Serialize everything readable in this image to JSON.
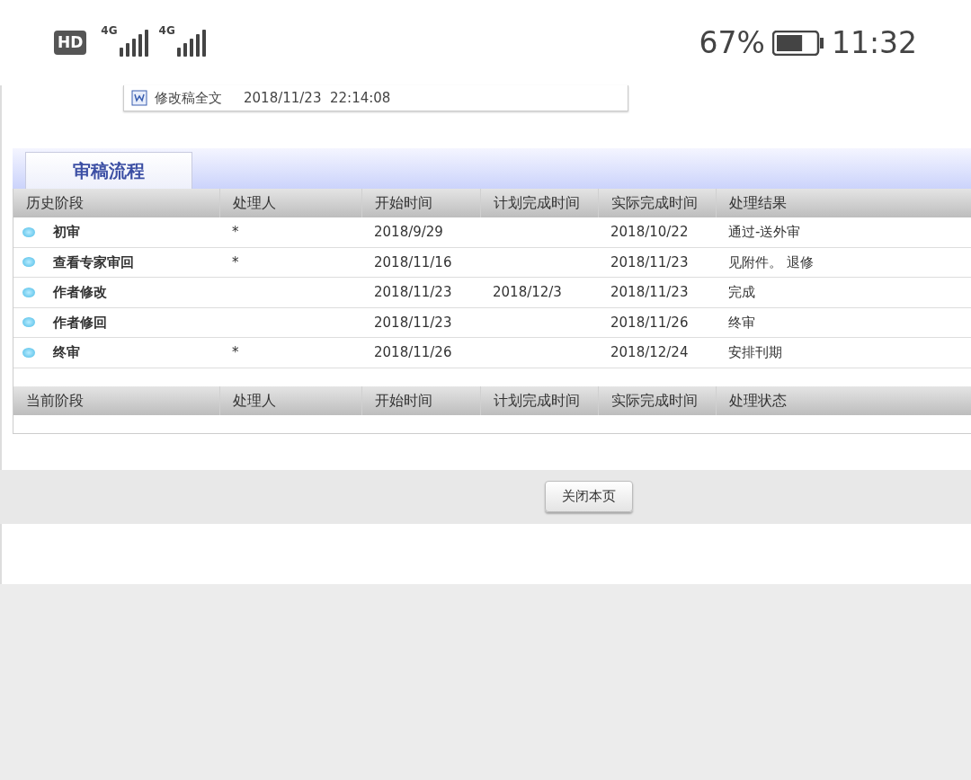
{
  "status_bar": {
    "hd": "HD",
    "sim_1": "4G",
    "sim_2": "4G",
    "battery": "67%",
    "time": "11:32"
  },
  "attachment": {
    "name": "修改稿全文",
    "timestamp": "2018/11/23  22:14:08"
  },
  "tabs": [
    {
      "label": "审稿流程",
      "selected": true
    }
  ],
  "history_table": {
    "columns": [
      "历史阶段",
      "处理人",
      "开始时间",
      "计划完成时间",
      "实际完成时间",
      "处理结果"
    ],
    "rows": [
      {
        "cells": [
          "初审",
          "*",
          "2018/9/29",
          "",
          "2018/10/22",
          "通过-送外审"
        ]
      },
      {
        "cells": [
          "查看专家审回",
          "*",
          "2018/11/16",
          "",
          "2018/11/23",
          "见附件。 退修"
        ]
      },
      {
        "cells": [
          "作者修改",
          "",
          "2018/11/23",
          "2018/12/3",
          "2018/11/23",
          "完成"
        ]
      },
      {
        "cells": [
          "作者修回",
          "",
          "2018/11/23",
          "",
          "2018/11/26",
          "终审"
        ]
      },
      {
        "cells": [
          "终审",
          "*",
          "2018/11/26",
          "",
          "2018/12/24",
          "安排刊期"
        ]
      }
    ]
  },
  "current_table": {
    "columns": [
      "当前阶段",
      "处理人",
      "开始时间",
      "计划完成时间",
      "实际完成时间",
      "处理状态"
    ]
  },
  "close_button": "关闭本页"
}
